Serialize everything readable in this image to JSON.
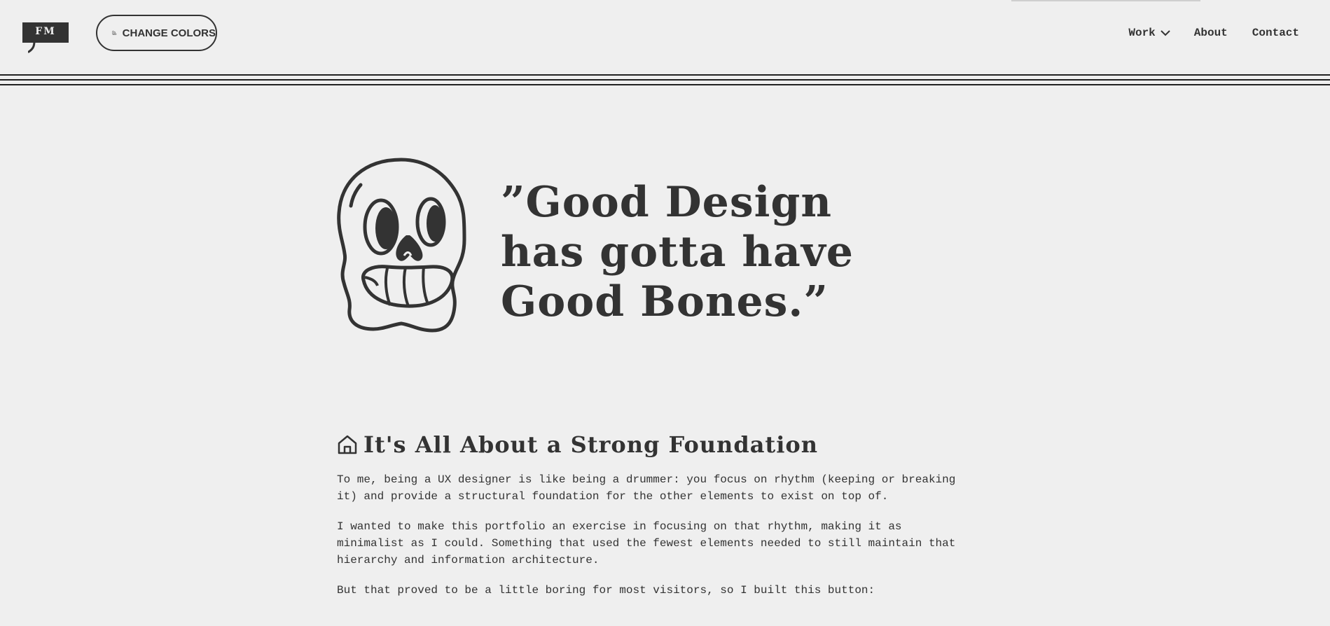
{
  "header": {
    "logo_text": "FM",
    "change_colors_label": "CHANGE COLORS",
    "nav": {
      "work": "Work",
      "about": "About",
      "contact": "Contact"
    }
  },
  "hero": {
    "quote": "”Good Design\nhas gotta have\nGood Bones.”"
  },
  "about": {
    "heading": "It's All About a Strong Foundation",
    "paragraphs": [
      "To me, being a UX designer is like being a drummer: you focus on rhythm (keeping or breaking it) and provide a structural foundation for the other elements to exist on top of.",
      "I wanted to make this portfolio an exercise in focusing on that rhythm, making it as minimalist as I could. Something that used the fewest elements needed to still maintain that hierarchy and information architecture.",
      "But that proved to be a little boring for most visitors, so I built this button:"
    ]
  },
  "icons": {
    "logo": "fm-logo-speech-bubble",
    "change_colors": "swatch-icon",
    "work_dropdown": "chevron-down-icon",
    "hero_illustration": "skull-icon",
    "section": "home-icon"
  },
  "colors": {
    "background": "#efefef",
    "ink": "#333333"
  }
}
